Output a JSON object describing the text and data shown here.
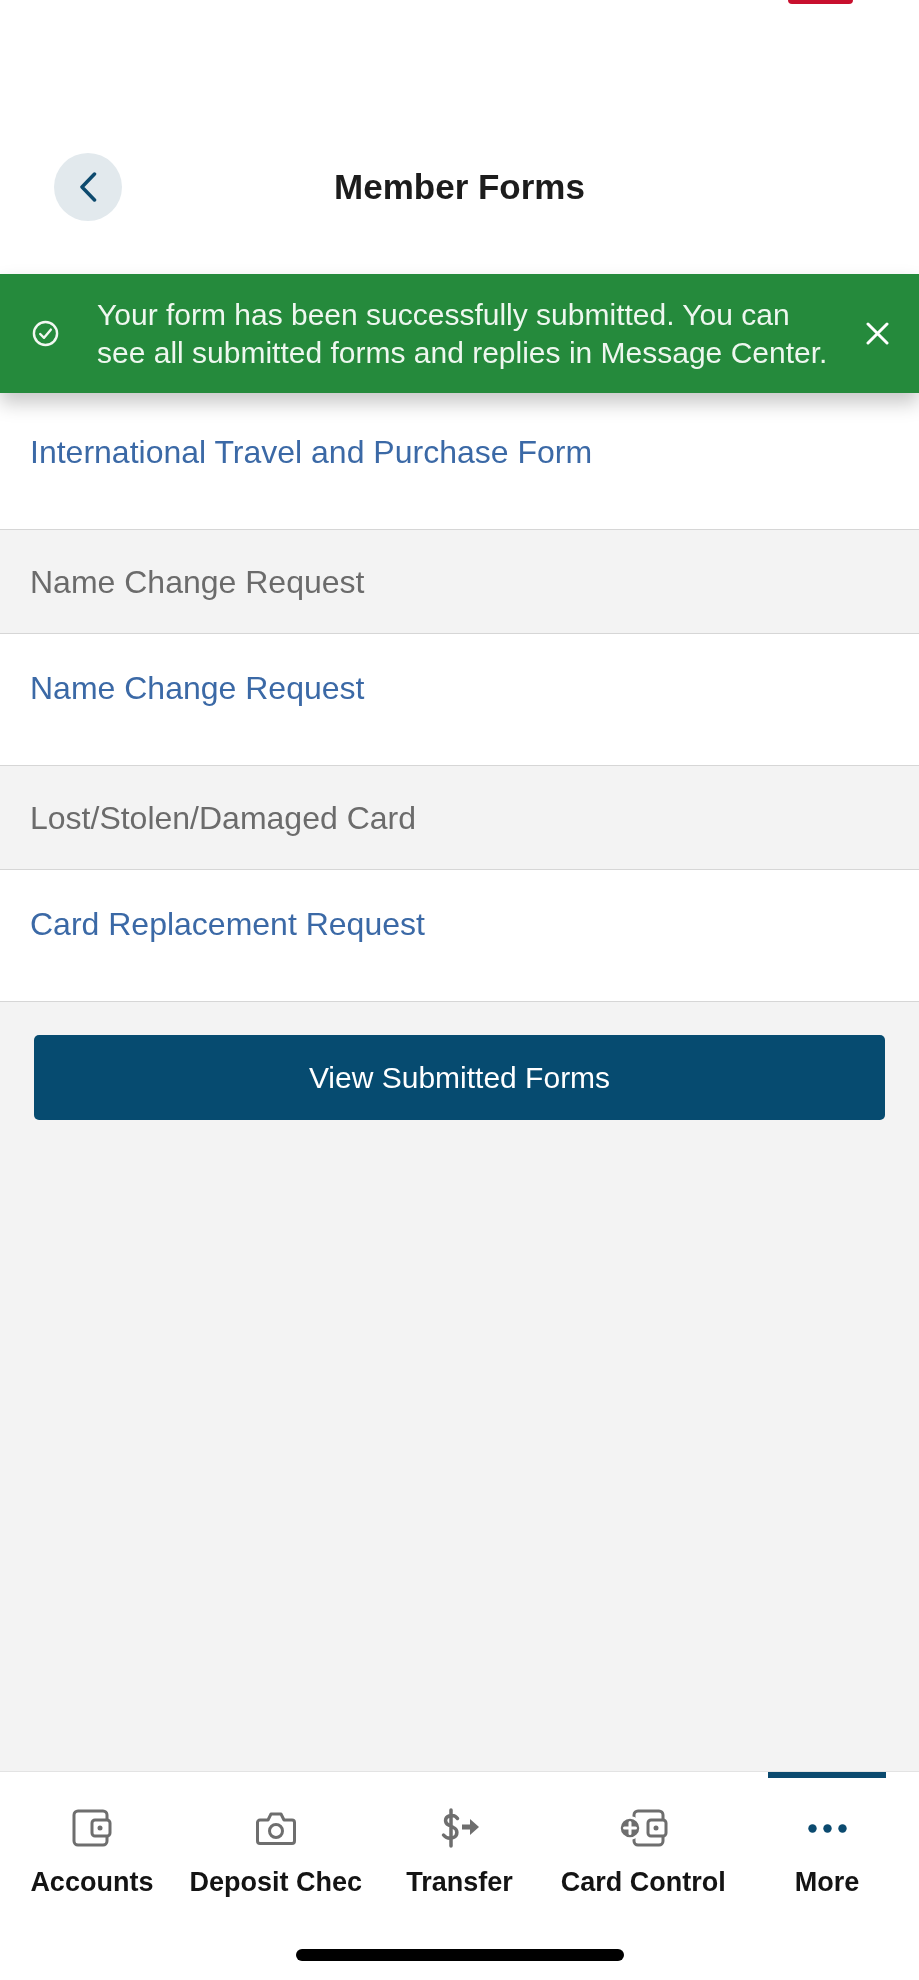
{
  "header": {
    "title": "Member Forms"
  },
  "banner": {
    "message": "Your form has been successfully submitted. You can see all submitted forms and replies in Message Center."
  },
  "form_list": [
    {
      "kind": "link",
      "label": "International Travel and Purchase Form"
    },
    {
      "kind": "section",
      "label": "Name Change Request"
    },
    {
      "kind": "link",
      "label": "Name Change Request"
    },
    {
      "kind": "section",
      "label": "Lost/Stolen/Damaged Card"
    },
    {
      "kind": "link",
      "label": "Card Replacement Request"
    }
  ],
  "primary_button": {
    "label": "View Submitted Forms"
  },
  "tab_bar": [
    {
      "label": "Accounts",
      "selected": false
    },
    {
      "label": "Deposit Chec",
      "selected": false
    },
    {
      "label": "Transfer",
      "selected": false
    },
    {
      "label": "Card Control",
      "selected": false
    },
    {
      "label": "More",
      "selected": true
    }
  ]
}
